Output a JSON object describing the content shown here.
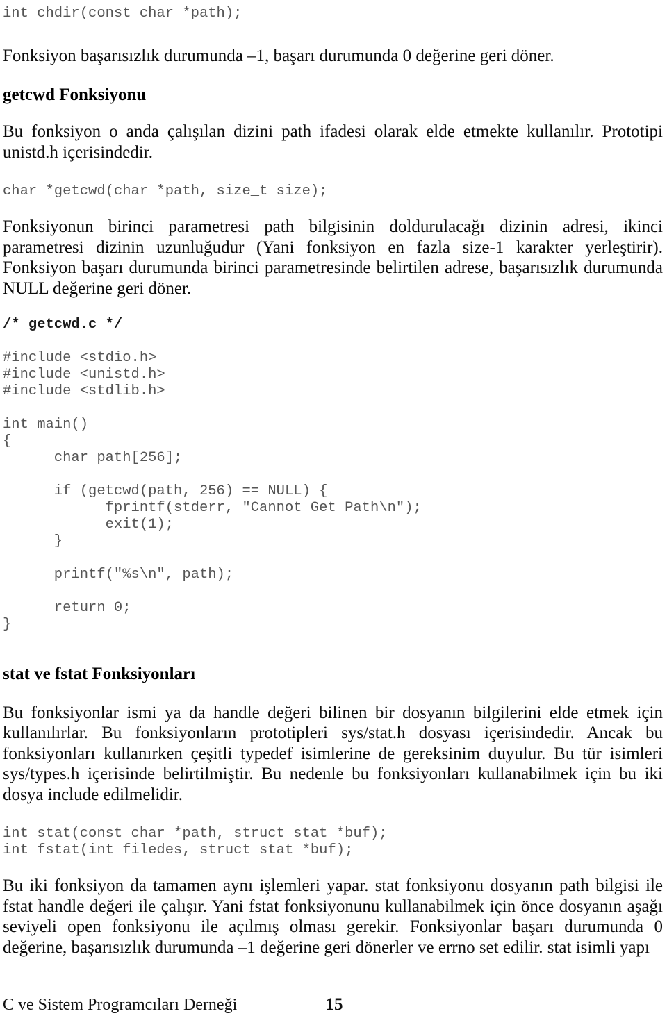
{
  "document": {
    "language": "tr",
    "page_number": "15",
    "footer_org": "C ve Sistem Programcıları Derneği"
  },
  "blocks": {
    "chdir_prototype": "int chdir(const char *path);",
    "chdir_return_para": "Fonksiyon başarısızlık durumunda –1, başarı durumunda 0 değerine geri döner.",
    "getcwd_heading": "getcwd Fonksiyonu",
    "getcwd_intro_para": "Bu fonksiyon o anda çalışılan dizini path ifadesi olarak elde etmekte kullanılır. Prototipi unistd.h içerisindedir.",
    "getcwd_prototype": "char *getcwd(char *path, size_t size);",
    "getcwd_desc_para": "Fonksiyonun birinci parametresi path bilgisinin doldurulacağı dizinin adresi, ikinci parametresi dizinin uzunluğudur (Yani fonksiyon en fazla size-1 karakter yerleştirir). Fonksiyon başarı durumunda birinci parametresinde belirtilen adrese, başarısızlık durumunda NULL değerine geri döner.",
    "getcwd_file_comment": "/* getcwd.c */",
    "getcwd_listing": "#include <stdio.h>\n#include <unistd.h>\n#include <stdlib.h>\n\nint main()\n{\n      char path[256];\n\n      if (getcwd(path, 256) == NULL) {\n            fprintf(stderr, \"Cannot Get Path\\n\");\n            exit(1);\n      }\n\n      printf(\"%s\\n\", path);\n\n      return 0;\n}",
    "stat_heading": "stat ve fstat Fonksiyonları",
    "stat_intro_para": "Bu fonksiyonlar ismi ya da handle değeri bilinen bir dosyanın bilgilerini elde etmek için kullanılırlar. Bu fonksiyonların prototipleri sys/stat.h dosyası içerisindedir. Ancak bu fonksiyonları kullanırken çeşitli typedef isimlerine de gereksinim duyulur. Bu tür isimleri sys/types.h içerisinde belirtilmiştir. Bu nedenle bu fonksiyonları kullanabilmek için bu iki dosya include edilmelidir.",
    "stat_prototypes": "int stat(const char *path, struct stat *buf);\nint fstat(int filedes, struct stat *buf);",
    "stat_desc_para": "Bu iki fonksiyon da tamamen aynı işlemleri yapar. stat fonksiyonu dosyanın path bilgisi ile fstat handle değeri ile çalışır. Yani fstat fonksiyonunu kullanabilmek için önce dosyanın aşağı seviyeli open fonksiyonu ile açılmış olması gerekir. Fonksiyonlar başarı durumunda 0 değerine, başarısızlık durumunda –1 değerine geri dönerler ve errno set edilir. stat isimli yapı"
  },
  "colors": {
    "page_background": "#ffffff",
    "body_text": "#0d0d0d",
    "code_text": "#555555",
    "heading_text": "#000000"
  }
}
